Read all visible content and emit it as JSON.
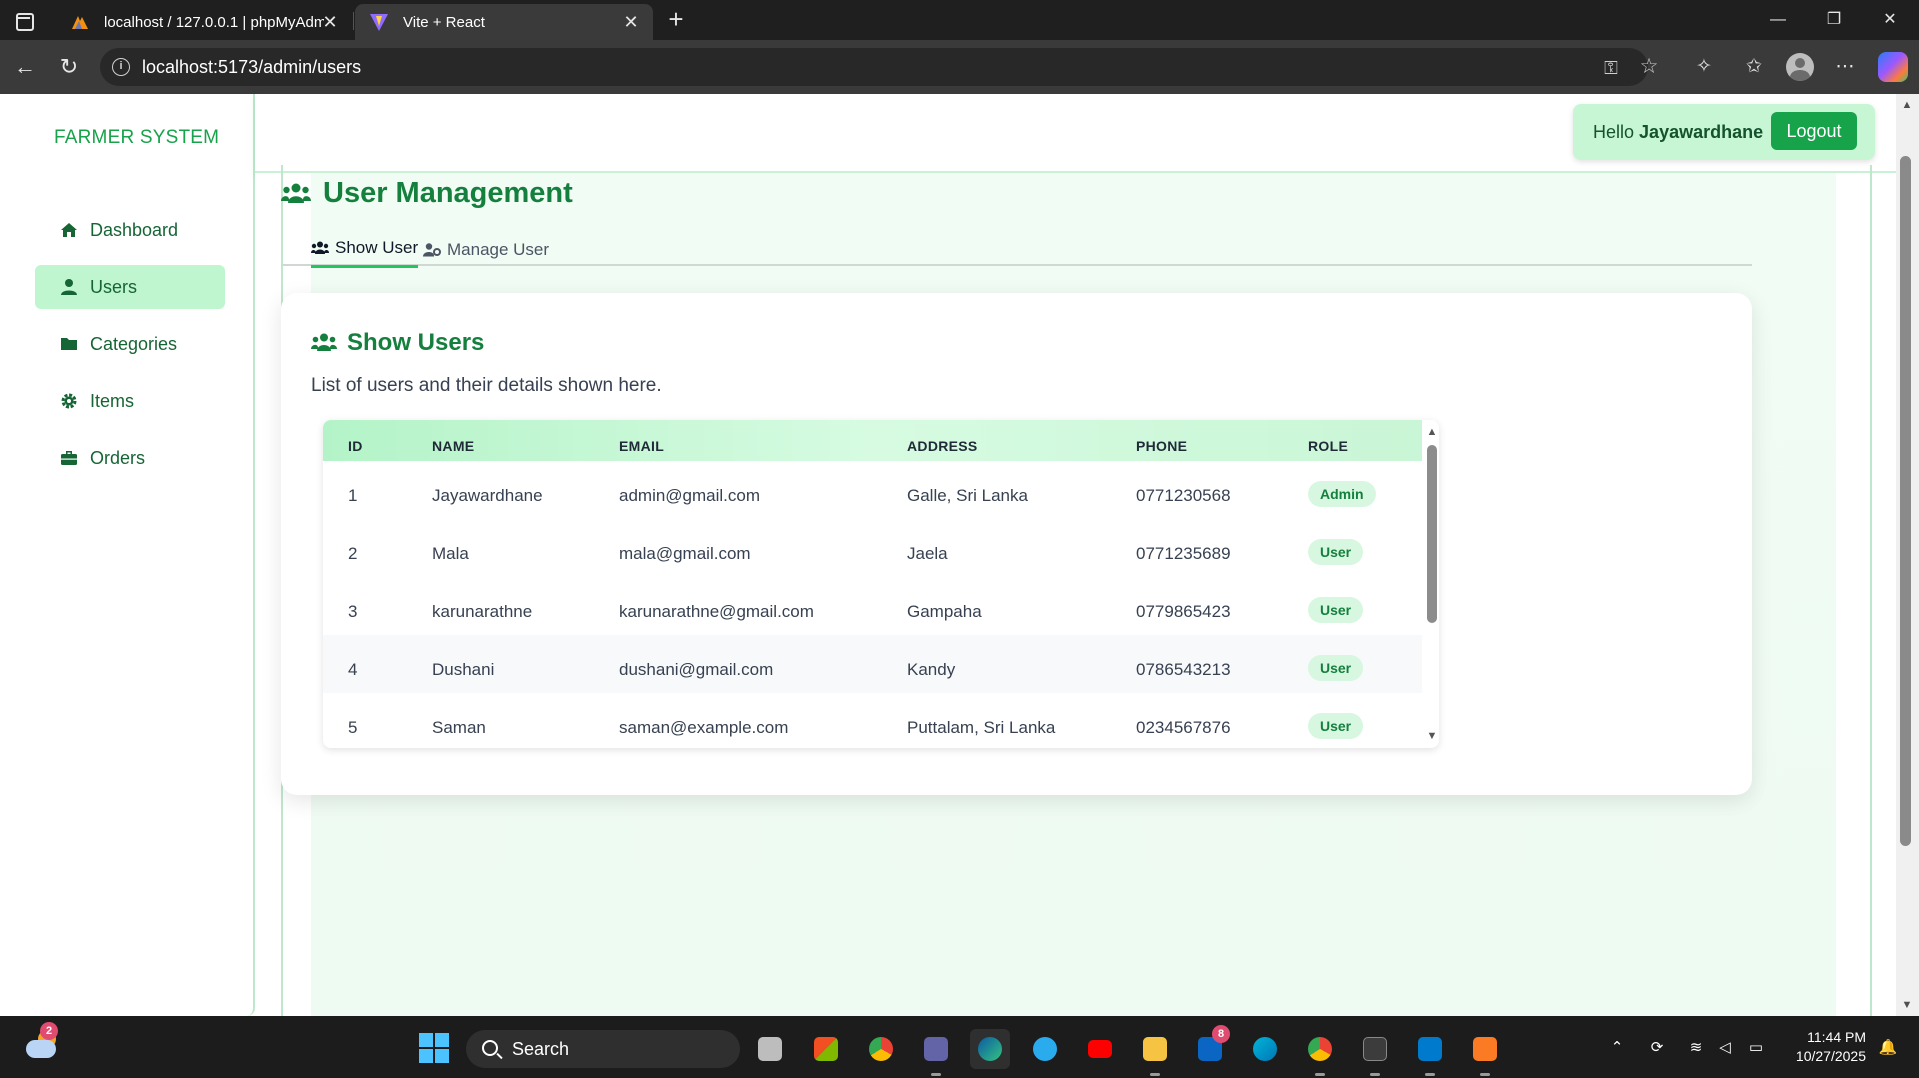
{
  "browser": {
    "tabs": [
      {
        "title": "localhost / 127.0.0.1 | phpMyAdm",
        "active": false
      },
      {
        "title": "Vite + React",
        "active": true
      }
    ],
    "url": "localhost:5173/admin/users"
  },
  "sidebar": {
    "brand": "FARMER SYSTEM",
    "items": [
      {
        "label": "Dashboard",
        "icon": "home-icon",
        "active": false
      },
      {
        "label": "Users",
        "icon": "user-icon",
        "active": true
      },
      {
        "label": "Categories",
        "icon": "folder-icon",
        "active": false
      },
      {
        "label": "Items",
        "icon": "gear-icon",
        "active": false
      },
      {
        "label": "Orders",
        "icon": "briefcase-icon",
        "active": false
      }
    ]
  },
  "header": {
    "greeting": "Hello",
    "username": "Jayawardhane",
    "logout_label": "Logout"
  },
  "main": {
    "title": "User Management",
    "tabs": [
      {
        "label": "Show User",
        "active": true
      },
      {
        "label": "Manage User",
        "active": false
      }
    ],
    "card": {
      "title": "Show Users",
      "description": "List of users and their details shown here."
    },
    "table": {
      "columns": [
        "ID",
        "NAME",
        "EMAIL",
        "ADDRESS",
        "PHONE",
        "ROLE"
      ],
      "rows": [
        {
          "id": "1",
          "name": "Jayawardhane",
          "email": "admin@gmail.com",
          "address": "Galle, Sri Lanka",
          "phone": "0771230568",
          "role": "Admin"
        },
        {
          "id": "2",
          "name": "Mala",
          "email": "mala@gmail.com",
          "address": "Jaela",
          "phone": "0771235689",
          "role": "User"
        },
        {
          "id": "3",
          "name": "karunarathne",
          "email": "karunarathne@gmail.com",
          "address": "Gampaha",
          "phone": "0779865423",
          "role": "User"
        },
        {
          "id": "4",
          "name": "Dushani",
          "email": "dushani@gmail.com",
          "address": "Kandy",
          "phone": "0786543213",
          "role": "User"
        },
        {
          "id": "5",
          "name": "Saman",
          "email": "saman@example.com",
          "address": "Puttalam, Sri Lanka",
          "phone": "0234567876",
          "role": "User"
        }
      ]
    }
  },
  "taskbar": {
    "search_label": "Search",
    "weather_badge": "2",
    "linkedin_badge": "8",
    "time": "11:44 PM",
    "date": "10/27/2025"
  },
  "colors": {
    "accent": "#16a34a",
    "accent_dark": "#15803d",
    "active_nav_bg": "#bff5cf",
    "table_header_bg": "#b4f3c8"
  }
}
